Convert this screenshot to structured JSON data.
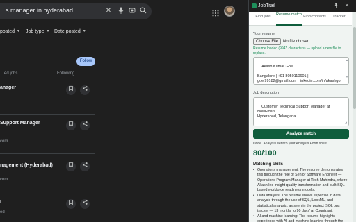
{
  "search": {
    "query": "s manager in hyderabad"
  },
  "filters": [
    {
      "label": "posted"
    },
    {
      "label": "Job type"
    },
    {
      "label": "Date posted"
    }
  ],
  "results_area": {
    "follow_label": "Follow",
    "tabs": [
      {
        "label": "ed jobs"
      },
      {
        "label": "Following"
      }
    ],
    "jobs": [
      {
        "title": "anager",
        "sub": ""
      },
      {
        "title": "Support Manager",
        "sub": "com"
      },
      {
        "title": "nagement (Hyderabad)",
        "sub": "com"
      },
      {
        "title": "r",
        "sub": "ed"
      }
    ]
  },
  "panel": {
    "title": "JobTrail",
    "tabs": [
      {
        "label": "Find jobs"
      },
      {
        "label": "Resume match"
      },
      {
        "label": "Find contacts"
      },
      {
        "label": "Tracker"
      }
    ],
    "active_tab": "Resume match",
    "resume_label": "Your resume",
    "choose_file_label": "Choose File",
    "file_status": "No file chosen",
    "resume_loaded_note": "Resume loaded (9947 characters) — upload a new file to replace.",
    "resume_text": "Akash Kumar Goel\n\nBangalore | +91 8050110601 |\ngoel99182@gmail.com | linkedin.com/in/akashgo\n\nAccomplished and Customer-Oriented",
    "job_description_label": "Job description",
    "job_description_text": "Customer Technical Support Manager at NowFloats\nHyderabad, Telangana",
    "analyze_label": "Analyze match",
    "done_note": "Done. Analysis sent to your Analysis Form sheet.",
    "score": "80/100",
    "matching_title": "Matching skills",
    "skills": [
      "Operations management: The resume demonstrates this through the role of Senior Software Engineer — Operations Program Manager at Tech Mahindra, where Akash led insight quality transformation and built SQL-based workforce readiness models.",
      "Data analysis: The resume shows expertise in data analysis through the use of SQL, LookML, and statistical analysis, as seen in the project 'SQL ops tracker — 13 months to 90 days' at Cognizant.",
      "AI and machine learning: The resume highlights experience with AI and machine learning through the"
    ],
    "colors": {
      "accent": "#0f5d3c",
      "note_green": "#1e8e5a",
      "panel_bg": "#f0f4f2"
    }
  }
}
